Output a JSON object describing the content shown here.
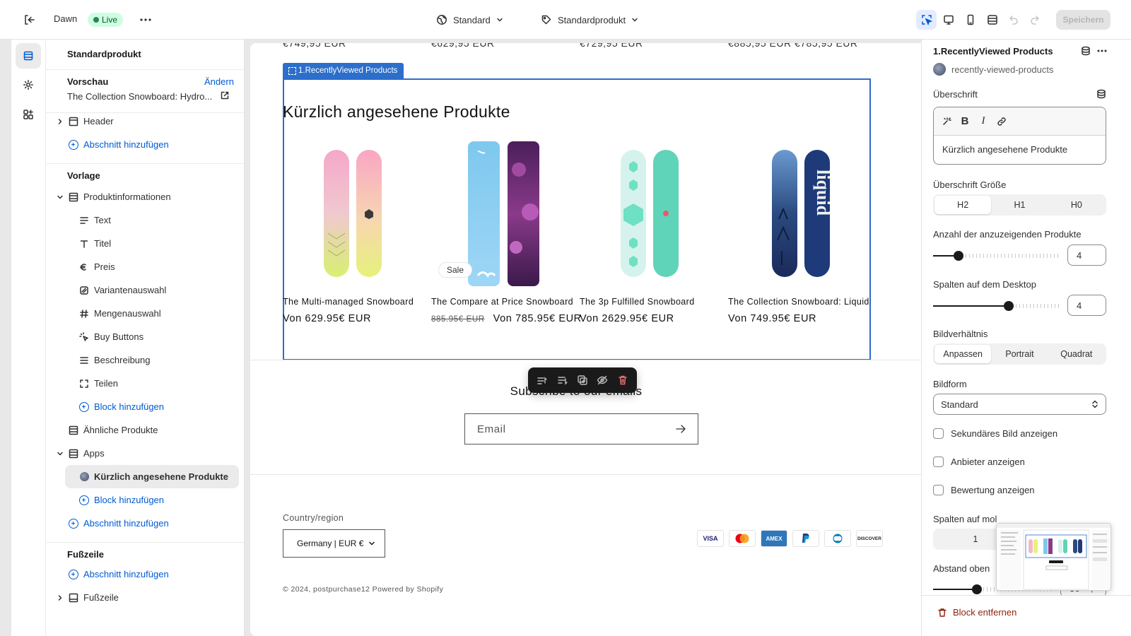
{
  "topbar": {
    "theme_name": "Dawn",
    "live_label": "Live",
    "template_select": "Standard",
    "product_select": "Standardprodukt",
    "save_label": "Speichern"
  },
  "sidebar": {
    "title": "Standardprodukt",
    "preview_label": "Vorschau",
    "change_label": "Ändern",
    "preview_value": "The Collection Snowboard: Hydro...",
    "header_item": "Header",
    "add_section": "Abschnitt hinzufügen",
    "template_group": "Vorlage",
    "product_info": "Produktinformationen",
    "blocks": [
      "Text",
      "Titel",
      "Preis",
      "Variantenauswahl",
      "Mengenauswahl",
      "Buy Buttons",
      "Beschreibung",
      "Teilen"
    ],
    "add_block": "Block hinzufügen",
    "similar_products": "Ähnliche Produkte",
    "apps": "Apps",
    "recently_viewed": "Kürzlich angesehene Produkte",
    "footer_group": "Fußzeile",
    "footer_item": "Fußzeile"
  },
  "canvas": {
    "cut_prices": [
      "€749,95 EUR",
      "€629,95 EUR",
      "€729,95 EUR",
      "€885,95 EUR €785,95 EUR"
    ],
    "section_tag": "1.RecentlyViewed Products",
    "heading": "Kürzlich angesehene Produkte",
    "products": [
      {
        "title": "The Multi-managed Snowboard",
        "price": "Von 629.95€ EUR",
        "old_price": ""
      },
      {
        "title": "The Compare at Price Snowboard",
        "price": "Von 785.95€ EUR",
        "old_price": "885.95€ EUR",
        "badge": "Sale"
      },
      {
        "title": "The 3p Fulfilled Snowboard",
        "price": "Von 2629.95€ EUR",
        "old_price": ""
      },
      {
        "title": "The Collection Snowboard: Liquid",
        "price": "Von 749.95€ EUR",
        "old_price": ""
      }
    ],
    "subscribe_title": "Subscribe to our emails",
    "email_placeholder": "Email",
    "country_label": "Country/region",
    "country_value": "Germany | EUR €",
    "payment_methods": [
      "VISA",
      "Mastercard",
      "AMEX",
      "PayPal",
      "Diners",
      "DISCOVER"
    ],
    "copyright": "© 2024, postpurchase12 Powered by Shopify"
  },
  "panel": {
    "title": "1.RecentlyViewed Products",
    "app_handle": "recently-viewed-products",
    "heading_label": "Überschrift",
    "heading_value": "Kürzlich angesehene Produkte",
    "heading_size_label": "Überschrift Größe",
    "heading_sizes": [
      "H2",
      "H1",
      "H0"
    ],
    "heading_size_selected": "H2",
    "num_products_label": "Anzahl der anzuzeigenden Produkte",
    "num_products": "4",
    "num_products_fraction": 0.2,
    "desktop_cols_label": "Spalten auf dem Desktop",
    "desktop_cols": "4",
    "desktop_cols_fraction": 0.6,
    "ratio_label": "Bildverhältnis",
    "ratios": [
      "Anpassen",
      "Portrait",
      "Quadrat"
    ],
    "ratio_selected": "Anpassen",
    "shape_label": "Bildform",
    "shape_value": "Standard",
    "checkboxes": [
      "Sekundäres Bild anzeigen",
      "Anbieter anzeigen",
      "Bewertung anzeigen"
    ],
    "mobile_cols_label": "Spalten auf mol",
    "mobile_cols_value": "1",
    "padding_top_label": "Abstand oben",
    "padding_top_value": "36",
    "padding_unit": "px",
    "remove_block": "Block entfernen"
  },
  "colors": {
    "accent": "#005bd3",
    "selection": "#2c6ecb",
    "live_bg": "#cdfee1",
    "danger": "#8e1f0b"
  }
}
